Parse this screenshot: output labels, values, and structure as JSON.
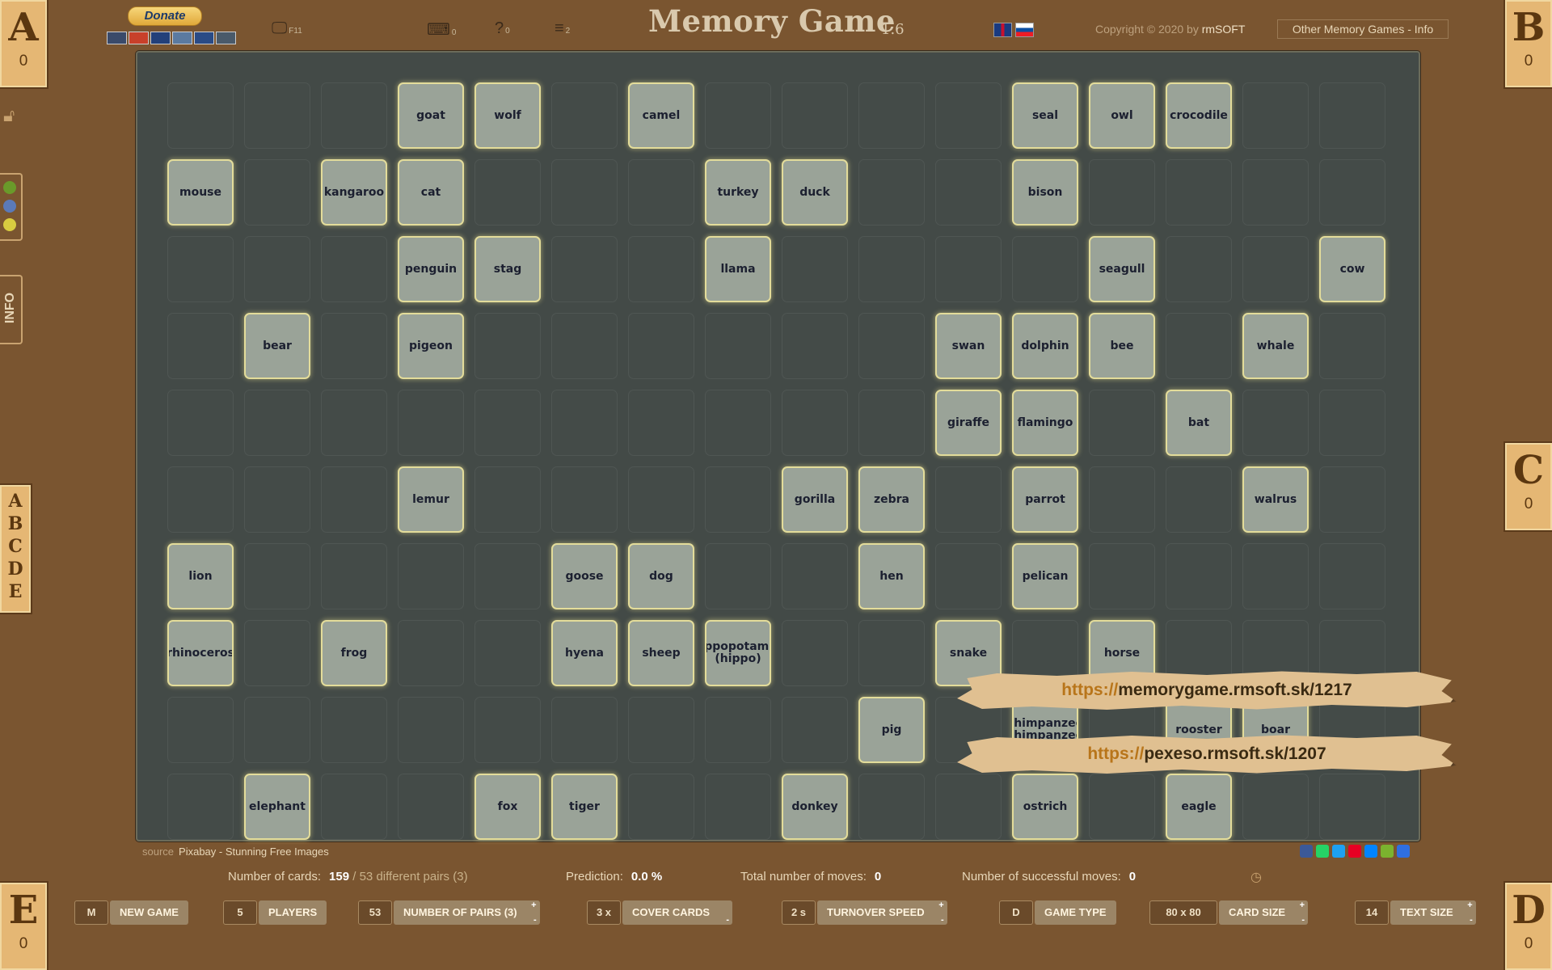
{
  "header": {
    "donate_label": "Donate",
    "fullscreen_key": "F11",
    "keyboard_badge": "0",
    "help_badge": "0",
    "menu_badge": "2",
    "title": "Memory Game",
    "version": "1.6",
    "copyright_prefix": "Copyright © 2020 by",
    "copyright_brand": "rmSOFT",
    "other_games_label": "Other Memory Games - Info"
  },
  "players": [
    {
      "letter": "A",
      "score": "0"
    },
    {
      "letter": "B",
      "score": "0"
    },
    {
      "letter": "C",
      "score": "0"
    },
    {
      "letter": "D",
      "score": "0"
    },
    {
      "letter": "E",
      "score": "0"
    }
  ],
  "sidebar": {
    "info_label": "INFO",
    "player_letters": [
      "A",
      "B",
      "C",
      "D",
      "E"
    ],
    "player_colors": [
      "#6a9a2a",
      "#5b7ab8",
      "#d8cc40"
    ]
  },
  "board": {
    "cols": 16,
    "rows": 10,
    "cards": [
      [
        "",
        "",
        "",
        "goat",
        "wolf",
        "",
        "camel",
        "",
        "",
        "",
        "",
        "seal",
        "owl",
        "crocodile",
        "",
        ""
      ],
      [
        "mouse",
        "",
        "kangaroo",
        "cat",
        "",
        "",
        "",
        "turkey",
        "duck",
        "",
        "",
        "bison",
        "",
        "",
        "",
        ""
      ],
      [
        "",
        "",
        "",
        "penguin",
        "stag",
        "",
        "",
        "llama",
        "",
        "",
        "",
        "",
        "seagull",
        "",
        "",
        "cow"
      ],
      [
        "",
        "bear",
        "",
        "pigeon",
        "",
        "",
        "",
        "",
        "",
        "",
        "swan",
        "dolphin",
        "bee",
        "",
        "whale",
        ""
      ],
      [
        "",
        "",
        "",
        "",
        "",
        "",
        "",
        "",
        "",
        "",
        "giraffe",
        "flamingo",
        "",
        "bat",
        "",
        ""
      ],
      [
        "",
        "",
        "",
        "lemur",
        "",
        "",
        "",
        "",
        "gorilla",
        "zebra",
        "",
        "parrot",
        "",
        "",
        "walrus",
        ""
      ],
      [
        "lion",
        "",
        "",
        "",
        "",
        "goose",
        "dog",
        "",
        "",
        "hen",
        "",
        "pelican",
        "",
        "",
        "",
        ""
      ],
      [
        "rhinoceros",
        "",
        "frog",
        "",
        "",
        "hyena",
        "sheep",
        "hippopotamus (hippo)",
        "",
        "",
        "snake",
        "",
        "horse",
        "",
        "",
        ""
      ],
      [
        "",
        "",
        "",
        "",
        "",
        "",
        "",
        "",
        "",
        "pig",
        "",
        "chimpanzee (chimpanzee)",
        "",
        "rooster",
        "boar",
        ""
      ],
      [
        "",
        "elephant",
        "",
        "",
        "fox",
        "tiger",
        "",
        "",
        "donkey",
        "",
        "",
        "ostrich",
        "",
        "eagle",
        "",
        ""
      ]
    ]
  },
  "banners": [
    {
      "proto": "https://",
      "host": "memorygame.rmsoft.sk/1217"
    },
    {
      "proto": "https://",
      "host": "pexeso.rmsoft.sk/1207"
    }
  ],
  "footer": {
    "source_label": "source",
    "source_name": "Pixabay - Stunning Free Images",
    "cards_label": "Number of cards:",
    "cards_value": "159",
    "pairs_value": "/ 53",
    "pairs_suffix": "different pairs (3)",
    "prediction_label": "Prediction:",
    "prediction_value": "0.0 %",
    "moves_label": "Total number of moves:",
    "moves_value": "0",
    "success_label": "Number of successful moves:",
    "success_value": "0"
  },
  "controls": [
    {
      "key": "M",
      "label": "NEW GAME"
    },
    {
      "key": "5",
      "label": "PLAYERS"
    },
    {
      "key": "53",
      "label": "NUMBER OF PAIRS (3)"
    },
    {
      "key": "3 x",
      "label": "COVER CARDS"
    },
    {
      "key": "2 s",
      "label": "TURNOVER SPEED"
    },
    {
      "key": "D",
      "label": "GAME TYPE"
    },
    {
      "key": "80 x 80",
      "label": "CARD SIZE"
    },
    {
      "key": "14",
      "label": "TEXT SIZE"
    }
  ],
  "social_colors": [
    "#3b5998",
    "#25d366",
    "#1da1f2",
    "#e60023",
    "#0084ff",
    "#7bb32e",
    "#2f6fe0"
  ]
}
